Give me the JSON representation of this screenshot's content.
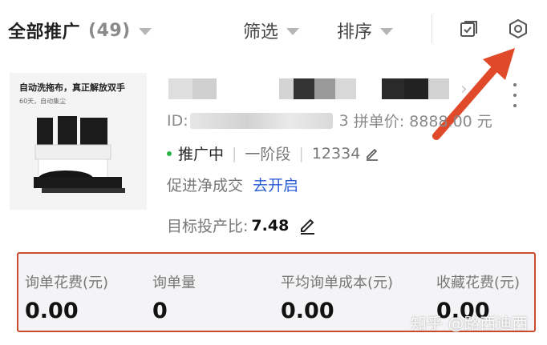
{
  "header": {
    "title": "全部推广",
    "count": "(49)",
    "filter_label": "筛选",
    "sort_label": "排序",
    "check_icon": "checklist-icon",
    "settings_icon": "settings-hex-icon"
  },
  "product": {
    "thumb_headline": "自动洗拖布，真正解放双手",
    "thumb_subline": "60天，自动集尘",
    "id_prefix": "ID:",
    "id_suffix": "3",
    "price_label": "拼单价: 8888.00 元",
    "status": "推广中",
    "stage": "一阶段",
    "budget": "12334",
    "promo_label": "促进净成交",
    "promo_link": "去开启",
    "roi_label": "目标投产比:",
    "roi_value": "7.48"
  },
  "stats": [
    {
      "label": "询单花费(元)",
      "value": "0.00"
    },
    {
      "label": "询单量",
      "value": "0"
    },
    {
      "label": "平均询单成本(元)",
      "value": "0.00"
    },
    {
      "label": "收藏花费(元)",
      "value": "0.00"
    }
  ],
  "watermark": "知乎 @路西迪西",
  "colors": {
    "accent_link": "#2a5cd6",
    "status_green": "#2bb34a",
    "highlight_border": "#c94c2e",
    "arrow": "#e04a2a"
  }
}
